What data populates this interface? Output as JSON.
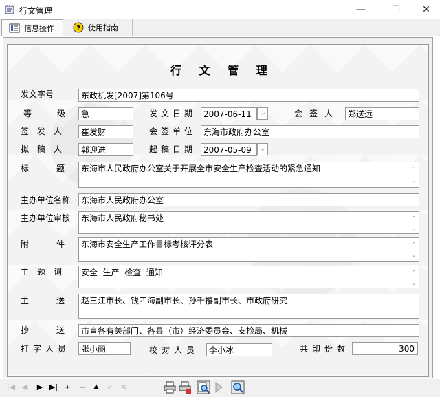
{
  "window": {
    "title": "行文管理",
    "minimize": "—",
    "maximize": "☐",
    "close": "✕"
  },
  "tabs": [
    {
      "label": "信息操作",
      "icon": "document-list-icon"
    },
    {
      "label": "使用指南",
      "icon": "help-icon"
    }
  ],
  "form": {
    "title": "行 文 管 理",
    "fields": {
      "doc_number": {
        "label": "发文字号",
        "value": "东政机发[2007]第106号"
      },
      "grade": {
        "label": "等级",
        "value": "急"
      },
      "issue_date": {
        "label": "发文日期",
        "value": "2007-06-11"
      },
      "countersigner": {
        "label": "会签人",
        "value": "郑送远"
      },
      "signer": {
        "label": "签发人",
        "value": "崔发财"
      },
      "countersign_unit": {
        "label": "会签单位",
        "value": "东海市政府办公室"
      },
      "drafter": {
        "label": "拟稿人",
        "value": "郭迎进"
      },
      "draft_date": {
        "label": "起稿日期",
        "value": "2007-05-09"
      },
      "subject": {
        "label": "标题",
        "value": "东海市人民政府办公室关于开展全市安全生产检查活动的紧急通知"
      },
      "host_unit": {
        "label": "主办单位名称",
        "value": "东海市人民政府办公室"
      },
      "host_review": {
        "label": "主办单位审核",
        "value": "东海市人民政府秘书处"
      },
      "attachment": {
        "label": "附件",
        "value": "东海市安全生产工作目标考核评分表"
      },
      "keywords": {
        "label": "主题词",
        "value": "安全  生产  检查  通知"
      },
      "send_to": {
        "label": "主送",
        "value": "赵三江市长、钱四海副市长、孙千禧副市长、市政府研究"
      },
      "copy_to": {
        "label": "抄送",
        "value": "市直各有关部门、各县（市）经济委员会、安检局、机械"
      },
      "typist": {
        "label": "打字人员",
        "value": "张小丽"
      },
      "proofreader": {
        "label": "校对人员",
        "value": "李小冰"
      },
      "copies": {
        "label": "共印份数",
        "value": "300"
      }
    }
  },
  "navigator": {
    "first": "|◀",
    "prior": "◀",
    "next": "▶",
    "last": "▶|",
    "insert": "+",
    "delete": "−",
    "edit": "▲",
    "post": "✓",
    "cancel": "✕"
  },
  "colors": {
    "titlebar": "#ffffff",
    "panel": "#f0f0f0",
    "field_border": "#9a9a9a"
  }
}
